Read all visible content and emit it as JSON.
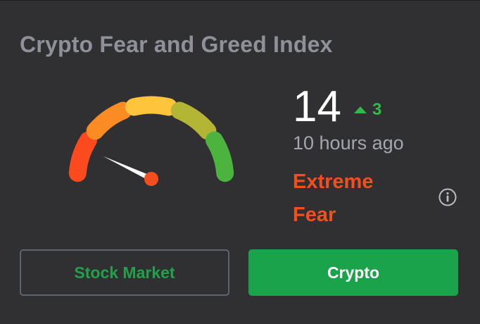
{
  "widget": {
    "title": "Crypto Fear and Greed Index",
    "value": "14",
    "change": "3",
    "change_direction": "up",
    "updated": "10 hours ago",
    "sentiment": "Extreme Fear",
    "index_fraction": 0.14
  },
  "gauge": {
    "segment_colors": [
      "#fb4b1e",
      "#fb8c23",
      "#fec53c",
      "#b3b534",
      "#4bb33e"
    ],
    "needle_color": "#ffffff",
    "pivot_color": "#f24e1e"
  },
  "tabs": {
    "stock_label": "Stock Market",
    "crypto_label": "Crypto",
    "active": "crypto"
  },
  "icons": {
    "info": "info-icon",
    "change_arrow": "arrow-up-icon"
  },
  "colors": {
    "background": "#303033",
    "title": "#8e9199",
    "positive": "#35b84a",
    "sentiment": "#f24e1e",
    "active_button": "#1aa34a"
  }
}
